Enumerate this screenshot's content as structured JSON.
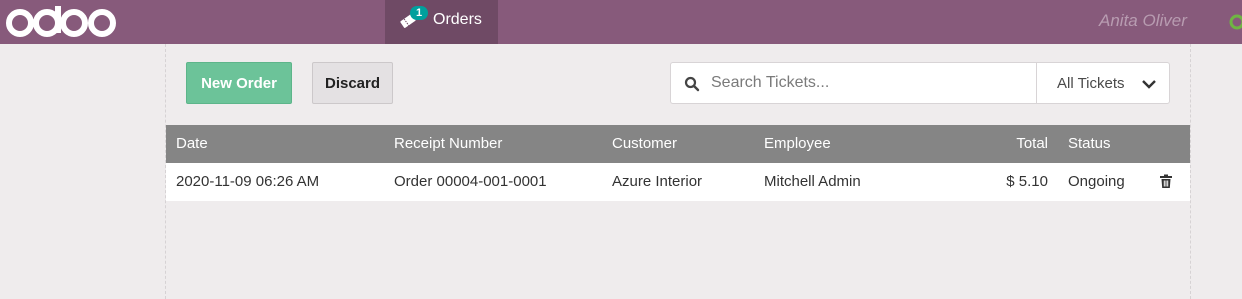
{
  "app": {
    "logo_text": "odoo"
  },
  "topbar": {
    "orders_tab": {
      "label": "Orders",
      "badge_count": "1"
    },
    "user_name": "Anita Oliver"
  },
  "toolbar": {
    "new_order_label": "New Order",
    "discard_label": "Discard",
    "search_placeholder": "Search Tickets...",
    "filter_selected": "All Tickets"
  },
  "table": {
    "columns": [
      "Date",
      "Receipt Number",
      "Customer",
      "Employee",
      "Total",
      "Status"
    ],
    "rows": [
      {
        "date": "2020-11-09 06:26 AM",
        "receipt": "Order 00004-001-0001",
        "customer": "Azure Interior",
        "employee": "Mitchell Admin",
        "total": "$ 5.10",
        "status": "Ongoing"
      }
    ]
  },
  "colors": {
    "topbar": "#875a7b",
    "new_order_button": "#6cc399",
    "table_header": "#858585",
    "badge": "#00a09d"
  },
  "icons": [
    "ticket-icon",
    "search-icon",
    "chevron-down-icon",
    "trash-icon",
    "connection-status-icon"
  ]
}
